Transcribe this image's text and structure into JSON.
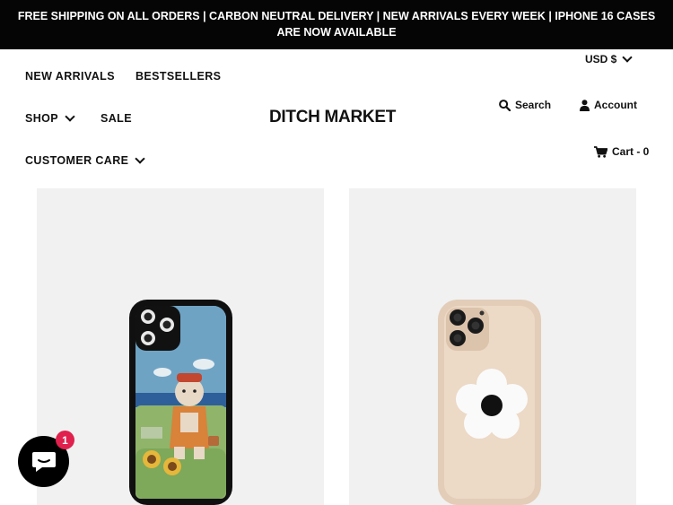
{
  "announcement": "FREE SHIPPING ON ALL ORDERS | CARBON NEUTRAL DELIVERY | NEW ARRIVALS EVERY WEEK | IPHONE 16 CASES ARE NOW AVAILABLE",
  "header": {
    "currency": "USD $",
    "logo": "DITCH MARKET",
    "nav": {
      "new_arrivals": "NEW ARRIVALS",
      "bestsellers": "BESTSELLERS",
      "shop": "SHOP",
      "sale": "SALE",
      "customer_care": "CUSTOMER CARE"
    },
    "search": "Search",
    "account": "Account",
    "cart": "Cart - 0"
  },
  "products": [
    {
      "image": "embroidered-bear-phone-case"
    },
    {
      "image": "beige-flower-grip-phone-case"
    }
  ],
  "chat": {
    "badge": "1"
  },
  "colors": {
    "announcement_bg": "#050505",
    "card_bg": "#f1f1f1",
    "badge": "#e0204d"
  }
}
